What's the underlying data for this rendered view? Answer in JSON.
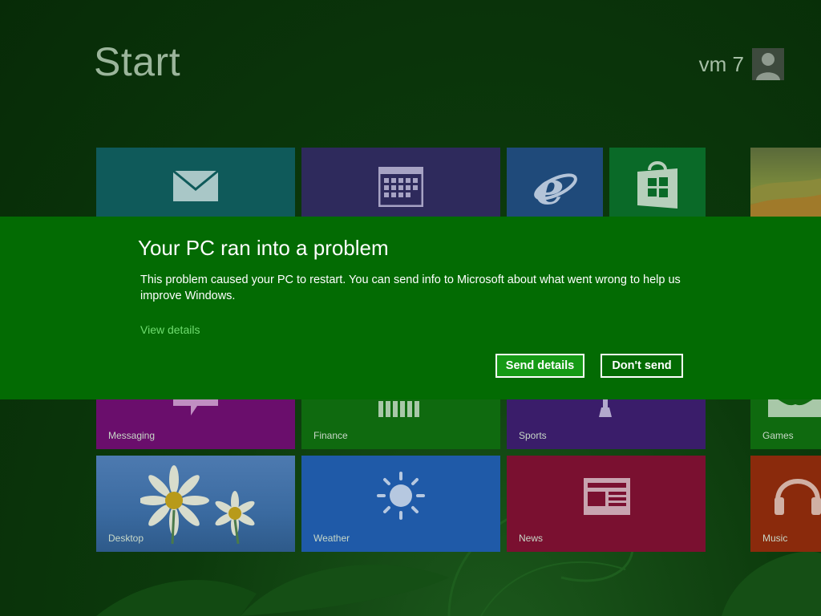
{
  "start": {
    "title": "Start"
  },
  "user": {
    "name": "vm 7"
  },
  "tiles": {
    "mail": {
      "icon": "mail-icon"
    },
    "calendar": {
      "icon": "calendar-icon"
    },
    "internet_explorer": {
      "icon": "internet-explorer-icon"
    },
    "store": {
      "icon": "store-icon"
    },
    "photos": {
      "icon": "photo-landscape"
    },
    "messaging": {
      "label": "Messaging"
    },
    "finance": {
      "label": "Finance"
    },
    "sports": {
      "label": "Sports"
    },
    "games": {
      "label": "Games"
    },
    "desktop": {
      "label": "Desktop"
    },
    "weather": {
      "label": "Weather"
    },
    "news": {
      "label": "News"
    },
    "music": {
      "label": "Music"
    }
  },
  "dialog": {
    "title": "Your PC ran into a problem",
    "body": "This problem caused your PC to restart. You can send info to Microsoft about what went wrong to help us improve Windows.",
    "view_details": "View details",
    "send_label": "Send details",
    "dont_send_label": "Don't send"
  },
  "colors": {
    "dialog_bg": "#036b03",
    "link": "#6fdc6f",
    "mail": "#0f5a5a",
    "calendar": "#2e2a5c",
    "ie": "#1f4a7a",
    "store": "#0a6a28",
    "messaging": "#6a0e6c",
    "finance": "#0f6a0f",
    "sports": "#3a1d6a",
    "desktop": "#3a6aa0",
    "weather": "#1f5aa8",
    "news": "#7a1030",
    "music": "#8a2a0c"
  }
}
